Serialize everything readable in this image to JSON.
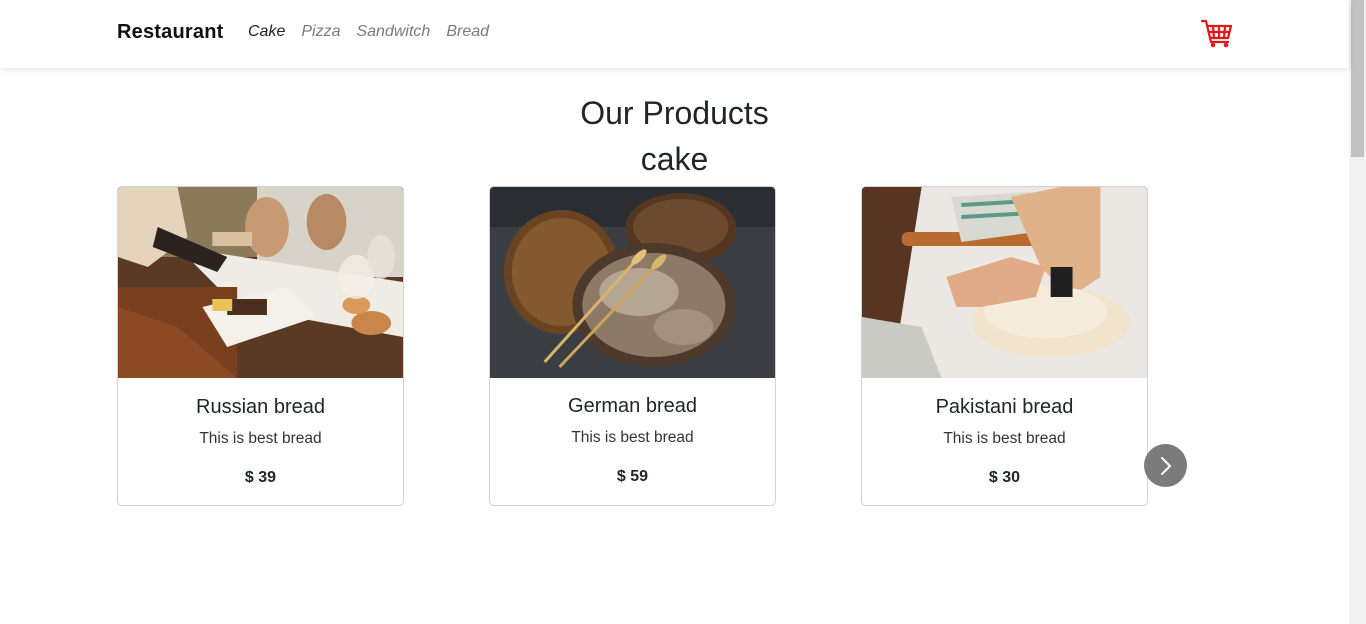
{
  "navbar": {
    "brand": "Restaurant",
    "links": [
      "Cake",
      "Pizza",
      "Sandwitch",
      "Bread"
    ],
    "active_link": "Cake",
    "cart_icon": "shopping-cart-icon",
    "cart_color": "#e01818"
  },
  "main": {
    "title": "Our Products",
    "category": "cake"
  },
  "products": [
    {
      "name": "Russian bread",
      "description": "This is best bread",
      "price": "$ 39",
      "image": "dinner-table-photo"
    },
    {
      "name": "German bread",
      "description": "This is best bread",
      "price": "$ 59",
      "image": "bread-loaves-photo"
    },
    {
      "name": "Pakistani bread",
      "description": "This is best bread",
      "price": "$ 30",
      "image": "kneading-dough-photo"
    }
  ],
  "carousel": {
    "next_icon": "chevron-right-icon"
  }
}
